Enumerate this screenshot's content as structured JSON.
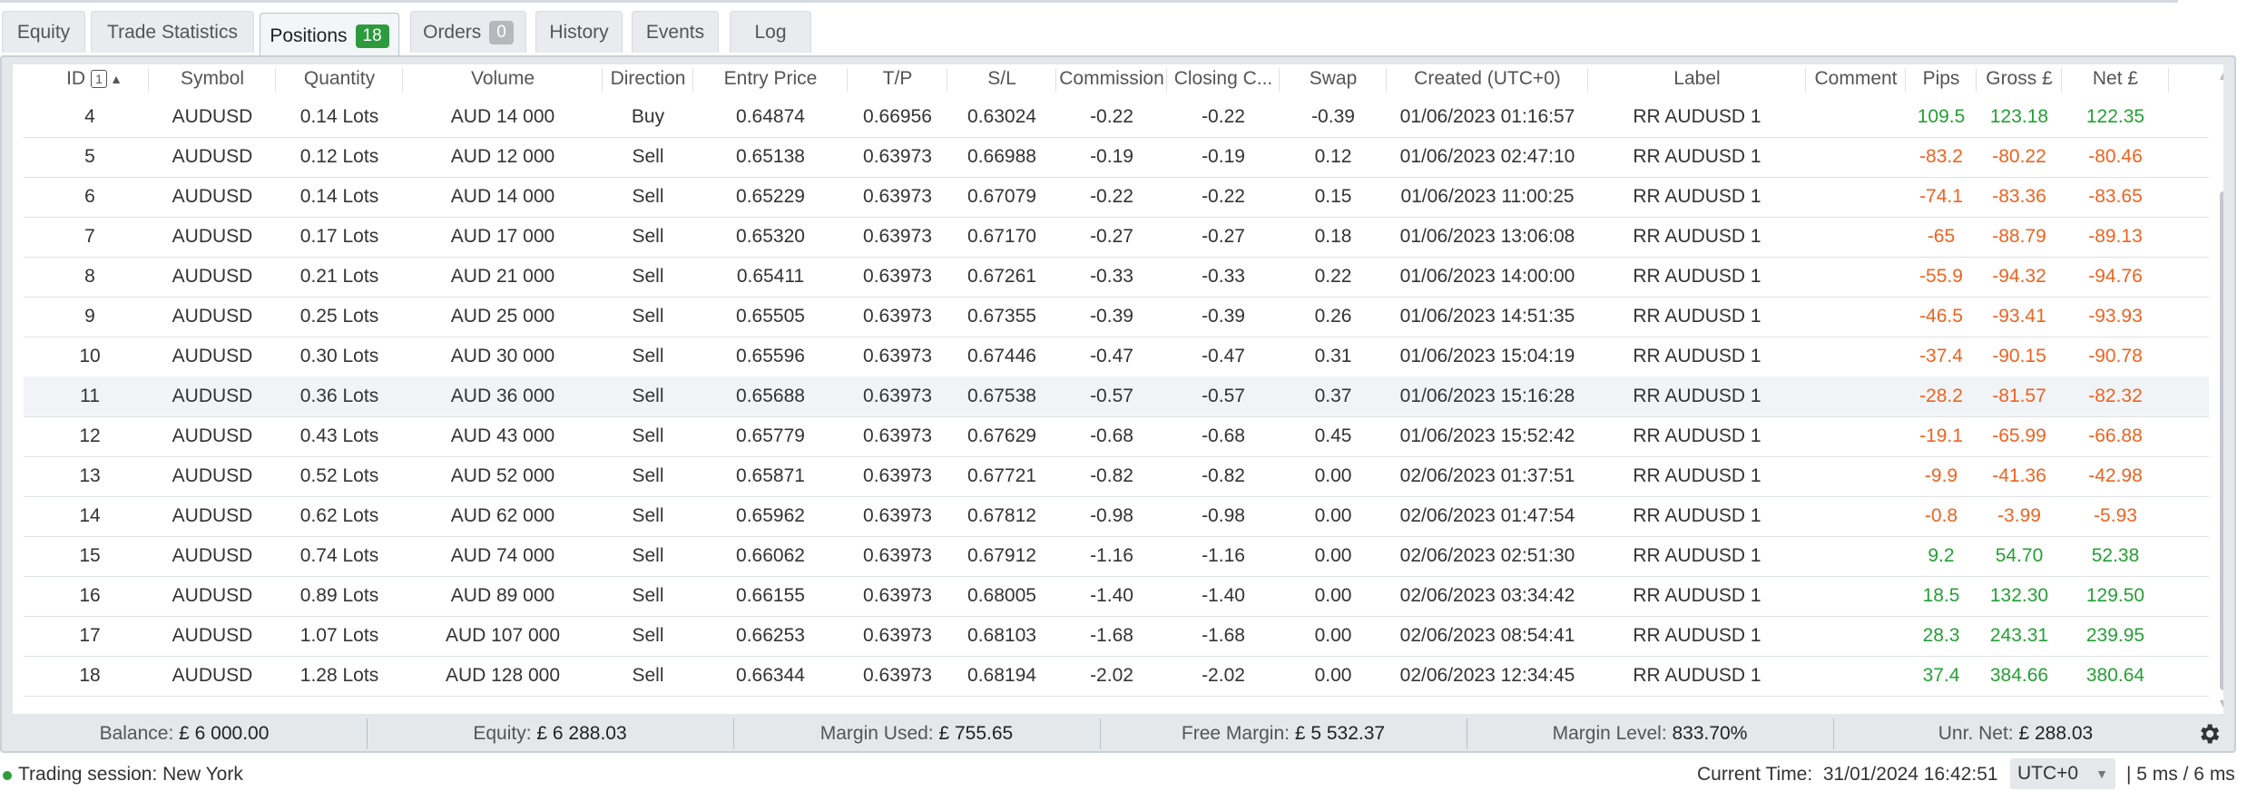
{
  "tabs": [
    {
      "label": "Equity"
    },
    {
      "label": "Trade Statistics"
    },
    {
      "label": "Positions",
      "badge": "18",
      "badge_color": "#2d9a3e"
    },
    {
      "label": "Orders",
      "badge": "0",
      "badge_color": "#b5b9bd"
    },
    {
      "label": "History"
    },
    {
      "label": "Events"
    },
    {
      "label": "Log"
    }
  ],
  "table": {
    "sort_index": "1",
    "sort_direction_icon": "sort-asc-icon",
    "columns": [
      "ID",
      "Symbol",
      "Quantity",
      "Volume",
      "Direction",
      "Entry Price",
      "T/P",
      "S/L",
      "Commission",
      "Closing C...",
      "Swap",
      "Created (UTC+0)",
      "Label",
      "Comment",
      "Pips",
      "Gross £",
      "Net £"
    ],
    "rows": [
      [
        "4",
        "AUDUSD",
        "0.14 Lots",
        "AUD 14 000",
        "Buy",
        "0.64874",
        "0.66956",
        "0.63024",
        "-0.22",
        "-0.22",
        "-0.39",
        "01/06/2023 01:16:57",
        "RR AUDUSD 1",
        "",
        "109.5",
        "123.18",
        "122.35"
      ],
      [
        "5",
        "AUDUSD",
        "0.12 Lots",
        "AUD 12 000",
        "Sell",
        "0.65138",
        "0.63973",
        "0.66988",
        "-0.19",
        "-0.19",
        "0.12",
        "01/06/2023 02:47:10",
        "RR AUDUSD 1",
        "",
        "-83.2",
        "-80.22",
        "-80.46"
      ],
      [
        "6",
        "AUDUSD",
        "0.14 Lots",
        "AUD 14 000",
        "Sell",
        "0.65229",
        "0.63973",
        "0.67079",
        "-0.22",
        "-0.22",
        "0.15",
        "01/06/2023 11:00:25",
        "RR AUDUSD 1",
        "",
        "-74.1",
        "-83.36",
        "-83.65"
      ],
      [
        "7",
        "AUDUSD",
        "0.17 Lots",
        "AUD 17 000",
        "Sell",
        "0.65320",
        "0.63973",
        "0.67170",
        "-0.27",
        "-0.27",
        "0.18",
        "01/06/2023 13:06:08",
        "RR AUDUSD 1",
        "",
        "-65",
        "-88.79",
        "-89.13"
      ],
      [
        "8",
        "AUDUSD",
        "0.21 Lots",
        "AUD 21 000",
        "Sell",
        "0.65411",
        "0.63973",
        "0.67261",
        "-0.33",
        "-0.33",
        "0.22",
        "01/06/2023 14:00:00",
        "RR AUDUSD 1",
        "",
        "-55.9",
        "-94.32",
        "-94.76"
      ],
      [
        "9",
        "AUDUSD",
        "0.25 Lots",
        "AUD 25 000",
        "Sell",
        "0.65505",
        "0.63973",
        "0.67355",
        "-0.39",
        "-0.39",
        "0.26",
        "01/06/2023 14:51:35",
        "RR AUDUSD 1",
        "",
        "-46.5",
        "-93.41",
        "-93.93"
      ],
      [
        "10",
        "AUDUSD",
        "0.30 Lots",
        "AUD 30 000",
        "Sell",
        "0.65596",
        "0.63973",
        "0.67446",
        "-0.47",
        "-0.47",
        "0.31",
        "01/06/2023 15:04:19",
        "RR AUDUSD 1",
        "",
        "-37.4",
        "-90.15",
        "-90.78"
      ],
      [
        "11",
        "AUDUSD",
        "0.36 Lots",
        "AUD 36 000",
        "Sell",
        "0.65688",
        "0.63973",
        "0.67538",
        "-0.57",
        "-0.57",
        "0.37",
        "01/06/2023 15:16:28",
        "RR AUDUSD 1",
        "",
        "-28.2",
        "-81.57",
        "-82.32"
      ],
      [
        "12",
        "AUDUSD",
        "0.43 Lots",
        "AUD 43 000",
        "Sell",
        "0.65779",
        "0.63973",
        "0.67629",
        "-0.68",
        "-0.68",
        "0.45",
        "01/06/2023 15:52:42",
        "RR AUDUSD 1",
        "",
        "-19.1",
        "-65.99",
        "-66.88"
      ],
      [
        "13",
        "AUDUSD",
        "0.52 Lots",
        "AUD 52 000",
        "Sell",
        "0.65871",
        "0.63973",
        "0.67721",
        "-0.82",
        "-0.82",
        "0.00",
        "02/06/2023 01:37:51",
        "RR AUDUSD 1",
        "",
        "-9.9",
        "-41.36",
        "-42.98"
      ],
      [
        "14",
        "AUDUSD",
        "0.62 Lots",
        "AUD 62 000",
        "Sell",
        "0.65962",
        "0.63973",
        "0.67812",
        "-0.98",
        "-0.98",
        "0.00",
        "02/06/2023 01:47:54",
        "RR AUDUSD 1",
        "",
        "-0.8",
        "-3.99",
        "-5.93"
      ],
      [
        "15",
        "AUDUSD",
        "0.74 Lots",
        "AUD 74 000",
        "Sell",
        "0.66062",
        "0.63973",
        "0.67912",
        "-1.16",
        "-1.16",
        "0.00",
        "02/06/2023 02:51:30",
        "RR AUDUSD 1",
        "",
        "9.2",
        "54.70",
        "52.38"
      ],
      [
        "16",
        "AUDUSD",
        "0.89 Lots",
        "AUD 89 000",
        "Sell",
        "0.66155",
        "0.63973",
        "0.68005",
        "-1.40",
        "-1.40",
        "0.00",
        "02/06/2023 03:34:42",
        "RR AUDUSD 1",
        "",
        "18.5",
        "132.30",
        "129.50"
      ],
      [
        "17",
        "AUDUSD",
        "1.07 Lots",
        "AUD 107 000",
        "Sell",
        "0.66253",
        "0.63973",
        "0.68103",
        "-1.68",
        "-1.68",
        "0.00",
        "02/06/2023 08:54:41",
        "RR AUDUSD 1",
        "",
        "28.3",
        "243.31",
        "239.95"
      ],
      [
        "18",
        "AUDUSD",
        "1.28 Lots",
        "AUD 128 000",
        "Sell",
        "0.66344",
        "0.63973",
        "0.68194",
        "-2.02",
        "-2.02",
        "0.00",
        "02/06/2023 12:34:45",
        "RR AUDUSD 1",
        "",
        "37.4",
        "384.66",
        "380.64"
      ]
    ],
    "colors": {
      "positive": "#25a035",
      "negative": "#ee6320"
    }
  },
  "summary": [
    {
      "label": "Balance:",
      "value": "£ 6 000.00"
    },
    {
      "label": "Equity:",
      "value": "£ 6 288.03"
    },
    {
      "label": "Margin Used:",
      "value": "£ 755.65"
    },
    {
      "label": "Free Margin:",
      "value": "£ 5 532.37"
    },
    {
      "label": "Margin Level:",
      "value": "833.70%"
    },
    {
      "label": "Unr. Net:",
      "value": "£ 288.03"
    }
  ],
  "status": {
    "session": "Trading session: New York",
    "current_time_label": "Current Time:",
    "current_time": "31/01/2024 16:42:51",
    "timezone": "UTC+0",
    "latency": "| 5 ms / 6 ms"
  }
}
